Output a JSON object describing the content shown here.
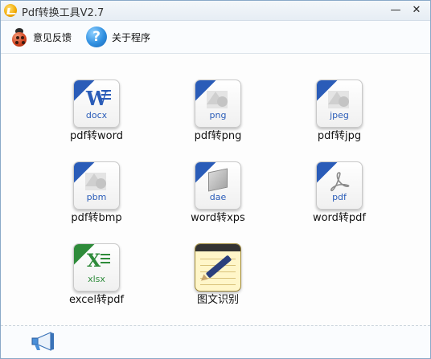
{
  "window": {
    "title": "Pdf转换工具V2.7",
    "min_label": "—",
    "close_label": "✕",
    "app_icon": "app-logo-icon"
  },
  "toolbar": {
    "items": [
      {
        "label": "意见反馈",
        "icon": "ladybug-icon"
      },
      {
        "label": "关于程序",
        "icon": "help-icon"
      }
    ]
  },
  "tools": [
    {
      "label": "pdf转word",
      "ext": "docx",
      "icon": "word-doc-icon",
      "accent": "#2a5cb8"
    },
    {
      "label": "pdf转png",
      "ext": "png",
      "icon": "png-image-icon",
      "accent": "#2a5cb8"
    },
    {
      "label": "pdf转jpg",
      "ext": "jpeg",
      "icon": "jpeg-image-icon",
      "accent": "#2a5cb8"
    },
    {
      "label": "pdf转bmp",
      "ext": "pbm",
      "icon": "bmp-image-icon",
      "accent": "#2a5cb8"
    },
    {
      "label": "word转xps",
      "ext": "dae",
      "icon": "xps-cube-icon",
      "accent": "#2a5cb8"
    },
    {
      "label": "word转pdf",
      "ext": "pdf",
      "icon": "pdf-doc-icon",
      "accent": "#2a5cb8"
    },
    {
      "label": "excel转pdf",
      "ext": "xlsx",
      "icon": "excel-doc-icon",
      "accent": "#2e8b3a"
    },
    {
      "label": "图文识别",
      "icon": "notebook-pen-icon"
    }
  ],
  "statusbar": {
    "icon": "megaphone-icon"
  }
}
